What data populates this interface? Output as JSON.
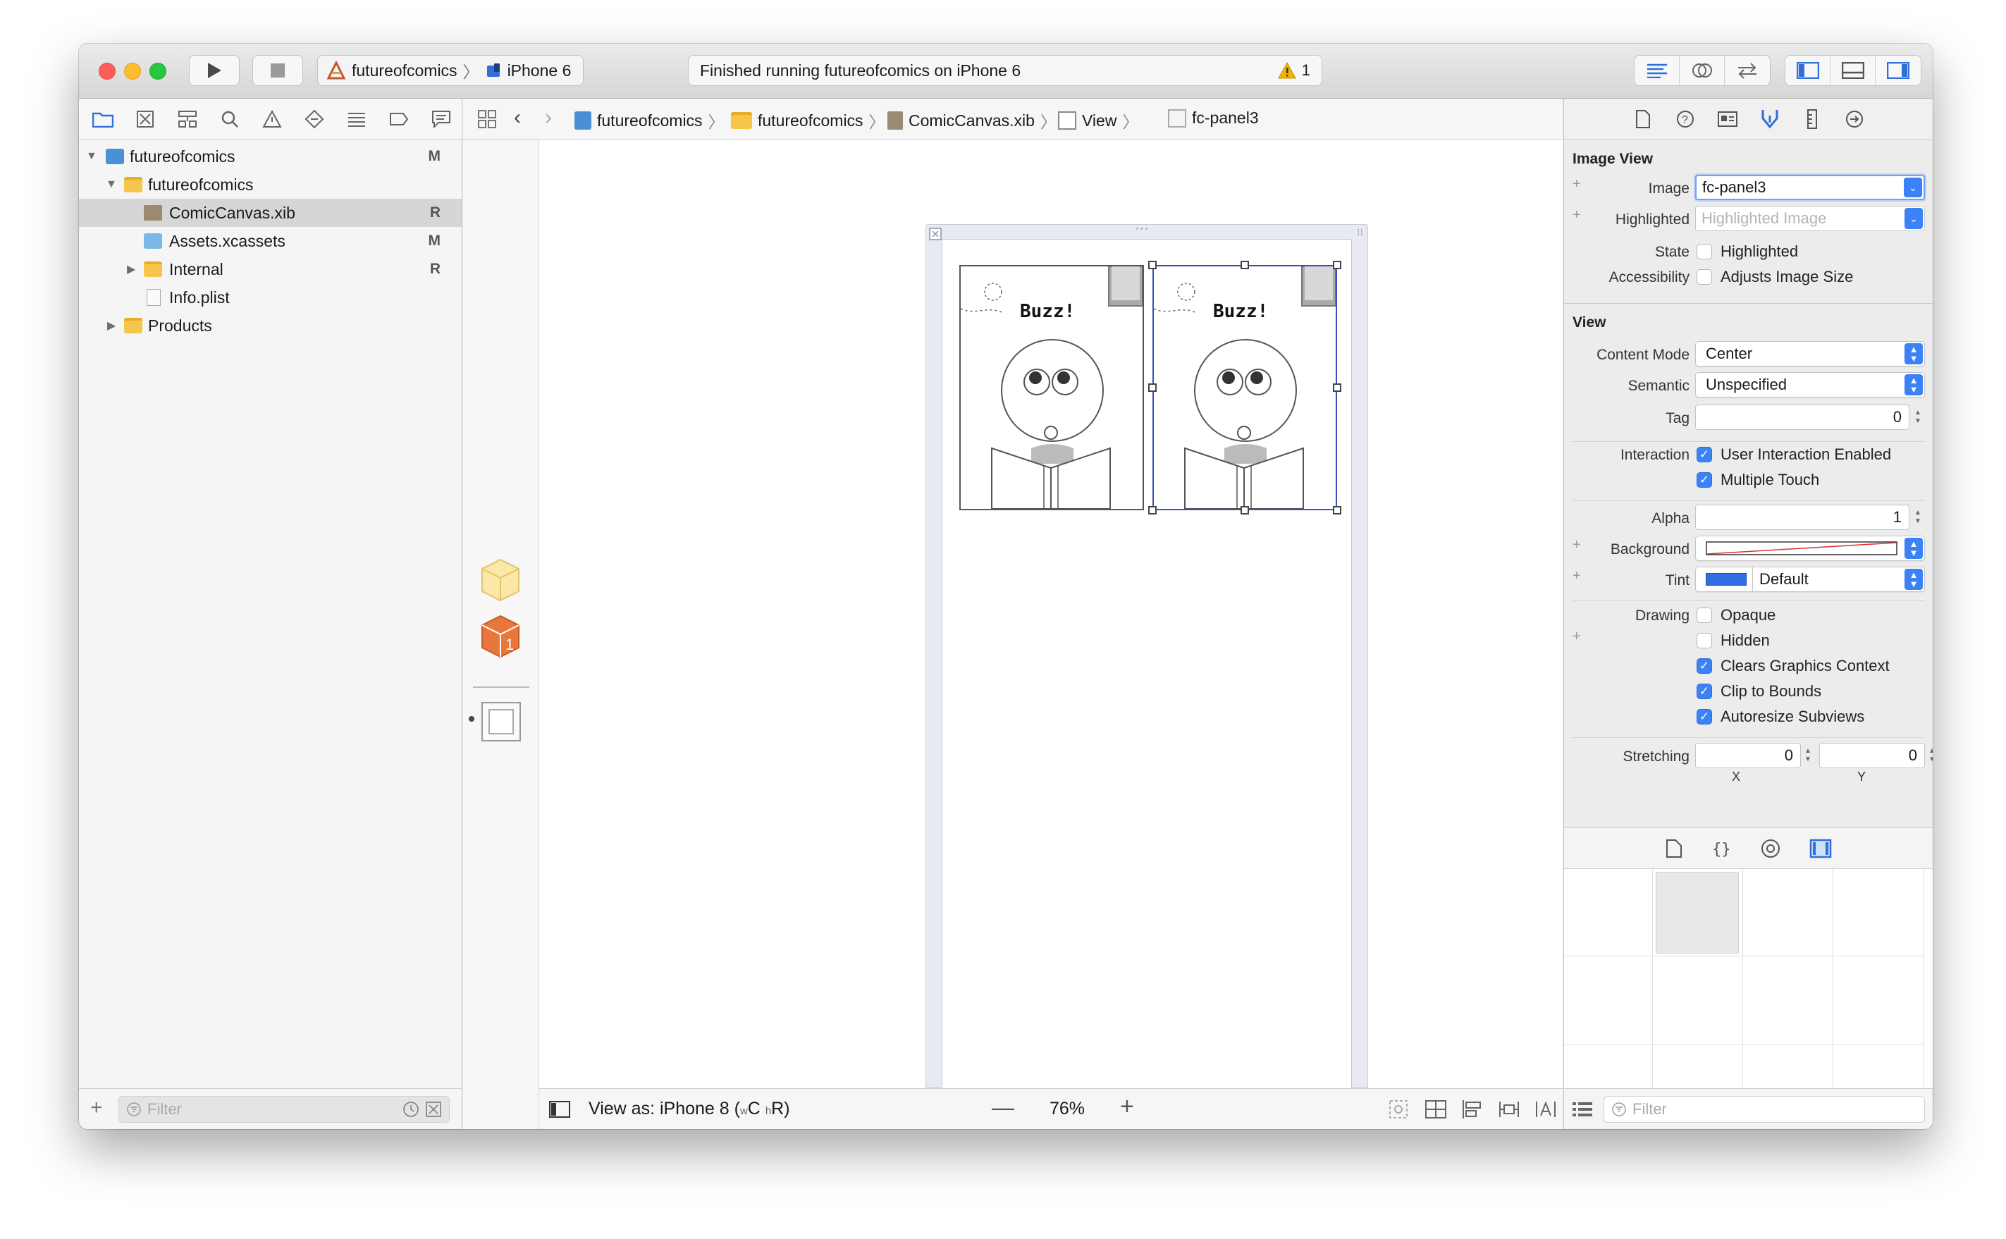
{
  "toolbar": {
    "scheme_project": "futureofcomics",
    "scheme_device": "iPhone 6",
    "activity_text": "Finished running futureofcomics on iPhone 6",
    "warning_count": "1"
  },
  "navigator": {
    "items": [
      {
        "label": "futureofcomics",
        "badge": "M"
      },
      {
        "label": "futureofcomics",
        "badge": ""
      },
      {
        "label": "ComicCanvas.xib",
        "badge": "R"
      },
      {
        "label": "Assets.xcassets",
        "badge": "M"
      },
      {
        "label": "Internal",
        "badge": "R"
      },
      {
        "label": "Info.plist",
        "badge": ""
      },
      {
        "label": "Products",
        "badge": ""
      }
    ],
    "filter_placeholder": "Filter"
  },
  "jumpbar": {
    "crumbs": [
      "futureofcomics",
      "futureofcomics",
      "ComicCanvas.xib",
      "View",
      "fc-panel3"
    ]
  },
  "canvas": {
    "panel_text": "Buzz!",
    "outline_badge": "1",
    "view_as_label": "View as: iPhone 8 (",
    "size_w": "w",
    "size_c": "C",
    "size_h": "h",
    "size_r": "R)",
    "zoom": "76%"
  },
  "inspector": {
    "image_view": {
      "title": "Image View",
      "image_label": "Image",
      "image_value": "fc-panel3",
      "highlighted_label": "Highlighted",
      "highlighted_placeholder": "Highlighted Image",
      "state_label": "State",
      "state_option": "Highlighted",
      "accessibility_label": "Accessibility",
      "accessibility_option": "Adjusts Image Size"
    },
    "view": {
      "title": "View",
      "content_mode_label": "Content Mode",
      "content_mode_value": "Center",
      "semantic_label": "Semantic",
      "semantic_value": "Unspecified",
      "tag_label": "Tag",
      "tag_value": "0",
      "interaction_label": "Interaction",
      "user_interaction": "User Interaction Enabled",
      "multiple_touch": "Multiple Touch",
      "alpha_label": "Alpha",
      "alpha_value": "1",
      "background_label": "Background",
      "tint_label": "Tint",
      "tint_value": "Default",
      "drawing_label": "Drawing",
      "opaque": "Opaque",
      "hidden": "Hidden",
      "clears_graphics": "Clears Graphics Context",
      "clip_to_bounds": "Clip to Bounds",
      "autoresize": "Autoresize Subviews",
      "stretching_label": "Stretching",
      "stretch_x_value": "0",
      "stretch_y_value": "0",
      "x_caption": "X",
      "y_caption": "Y"
    },
    "library_filter_placeholder": "Filter"
  },
  "colors": {
    "accent": "#3b82f6",
    "selection_border": "#3a52b8",
    "tint_swatch": "#2f6fe0"
  }
}
